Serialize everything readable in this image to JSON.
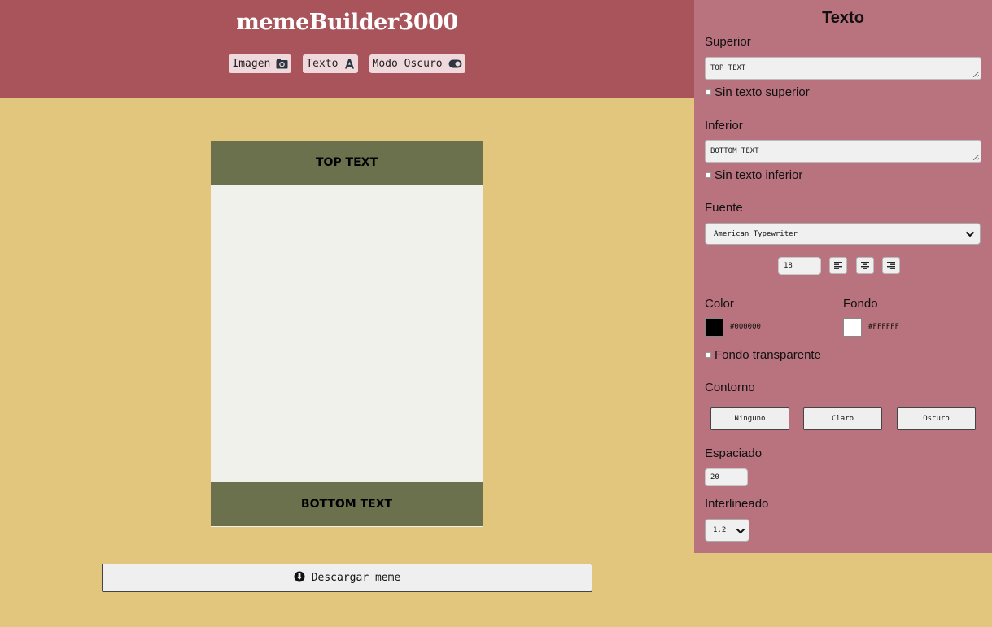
{
  "header": {
    "title": "memeBuilder3000",
    "nav": [
      {
        "label": "Imagen",
        "icon": "camera-icon"
      },
      {
        "label": "Texto",
        "icon": "font-icon"
      },
      {
        "label": "Modo Oscuro",
        "icon": "toggle-icon"
      }
    ]
  },
  "meme": {
    "top_text": "TOP TEXT",
    "bottom_text": "BOTTOM TEXT",
    "band_color": "#6b714c",
    "image_color": "#f1f1ec"
  },
  "download": {
    "label": "Descargar meme",
    "icon": "download-circle-icon"
  },
  "panel": {
    "title": "Texto",
    "top": {
      "label": "Superior",
      "value": "TOP TEXT",
      "no_text_label": "Sin texto superior"
    },
    "bottom": {
      "label": "Inferior",
      "value": "BOTTOM TEXT",
      "no_text_label": "Sin texto inferior"
    },
    "font": {
      "label": "Fuente",
      "selected": "American Typewriter",
      "size": "18",
      "align_icons": [
        "align-left-icon",
        "align-center-icon",
        "align-right-icon"
      ]
    },
    "color": {
      "label": "Color",
      "value": "#000000"
    },
    "background": {
      "label": "Fondo",
      "value": "#FFFFFF",
      "transparent_label": "Fondo transparente"
    },
    "outline": {
      "label": "Contorno",
      "options": [
        "Ninguno",
        "Claro",
        "Oscuro"
      ]
    },
    "spacing": {
      "label": "Espaciado",
      "value": "20"
    },
    "line_height": {
      "label": "Interlineado",
      "value": "1.2"
    }
  },
  "colors": {
    "page_bg": "#e2c67e",
    "header_bg": "#a8545a",
    "panel_bg": "#b8737e"
  }
}
